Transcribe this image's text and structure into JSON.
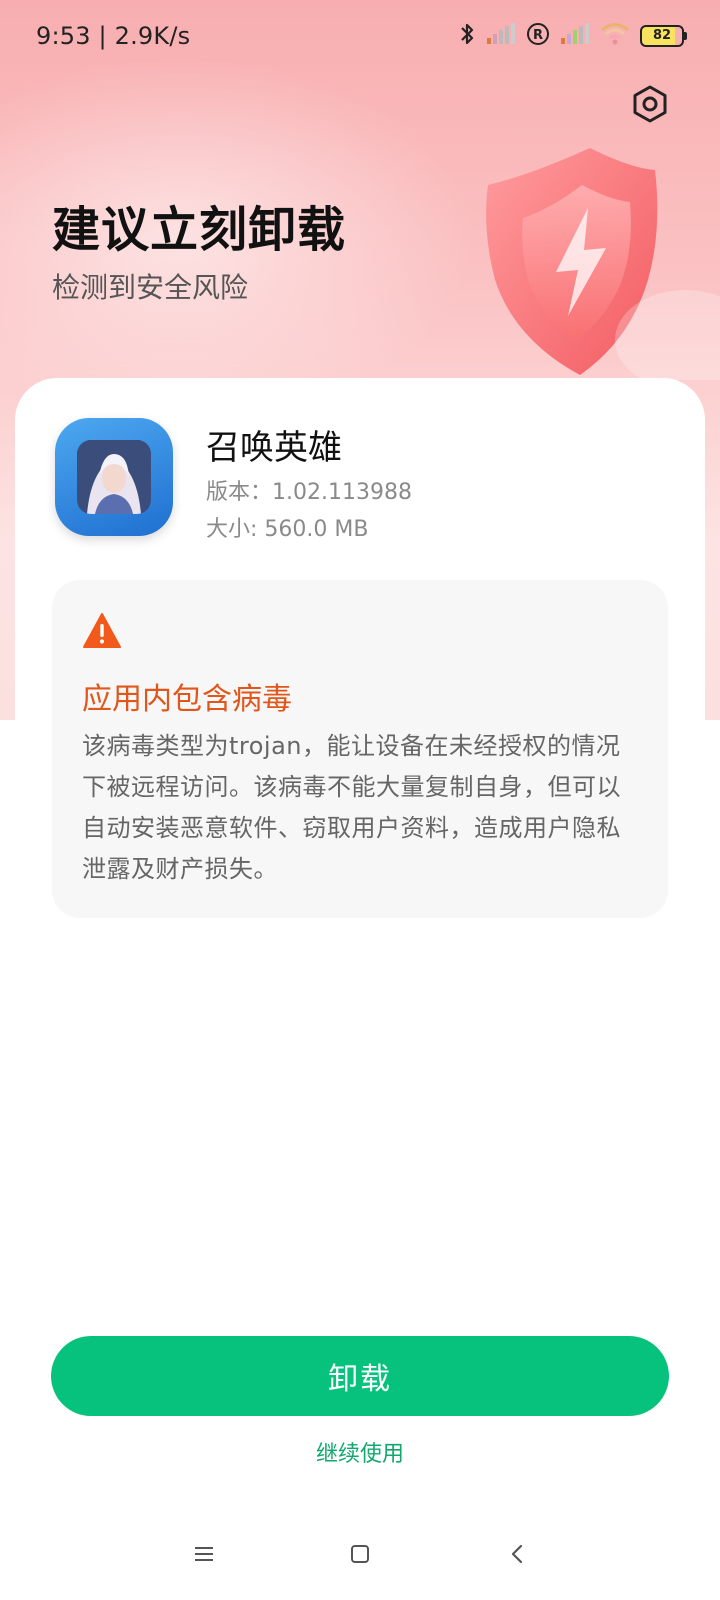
{
  "status_bar": {
    "time_speed": "9:53 | 2.9K/s",
    "battery": "82"
  },
  "hero": {
    "title": "建议立刻卸载",
    "subtitle": "检测到安全风险"
  },
  "app": {
    "name": "召唤英雄",
    "version": "版本：1.02.113988",
    "size": "大小: 560.0 MB"
  },
  "warning": {
    "title": "应用内包含病毒",
    "description": "该病毒类型为trojan，能让设备在未经授权的情况下被远程访问。该病毒不能大量复制自身，但可以自动安装恶意软件、窃取用户资料，造成用户隐私泄露及财产损失。"
  },
  "actions": {
    "uninstall_label": "卸载",
    "continue_label": "继续使用"
  },
  "icons": {
    "settings": "settings-icon",
    "warning": "warning-triangle-icon",
    "bluetooth": "bluetooth-icon",
    "signal": "signal-icon",
    "roaming": "roaming-icon",
    "wifi": "wifi-icon",
    "menu": "menu-icon",
    "home": "home-icon",
    "back": "back-icon"
  },
  "colors": {
    "accent_green": "#06c27c",
    "warning_orange": "#e0561b",
    "hero_pink": "#f8aeb0"
  }
}
